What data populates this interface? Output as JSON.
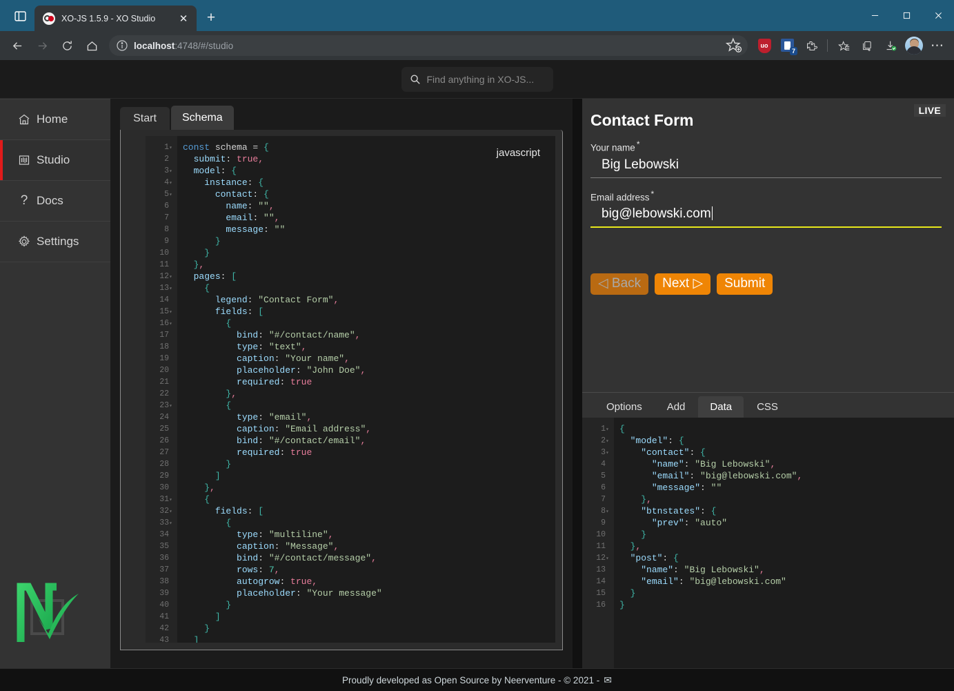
{
  "browser": {
    "tab_title": "XO-JS 1.5.9 - XO Studio",
    "tab_close_label": "✕",
    "new_tab_label": "+",
    "url_host": "localhost",
    "url_path": ":4748/#/studio",
    "extension_count": "7",
    "uo_label": "uo",
    "more_label": "⋯",
    "minimize_label": "─",
    "maximize_label": "□",
    "close_label": "✕"
  },
  "search": {
    "placeholder": "Find anything in XO-JS...",
    "icon": "search-icon"
  },
  "sidebar": {
    "items": [
      {
        "label": "Home",
        "icon": "home-icon",
        "active": false
      },
      {
        "label": "Studio",
        "icon": "studio-icon",
        "active": true
      },
      {
        "label": "Docs",
        "icon": "question-icon",
        "active": false
      },
      {
        "label": "Settings",
        "icon": "gear-icon",
        "active": false
      }
    ],
    "accent_color": "#e01b1b",
    "logo_name": "neerventure-logo"
  },
  "editor": {
    "tabs": [
      {
        "label": "Start",
        "active": false
      },
      {
        "label": "Schema",
        "active": true
      }
    ],
    "language_badge": "javascript",
    "line_count": 44,
    "fold_lines": [
      1,
      3,
      4,
      5,
      12,
      13,
      15,
      16,
      23,
      31,
      32,
      33
    ],
    "code": [
      [
        [
          "k",
          "const "
        ],
        [
          "op",
          "schema "
        ],
        [
          "op",
          "= "
        ],
        [
          "br",
          "{"
        ]
      ],
      [
        [
          "op",
          "  "
        ],
        [
          "p",
          "submit"
        ],
        [
          "op",
          ": "
        ],
        [
          "b",
          "true"
        ],
        [
          "b",
          ","
        ]
      ],
      [
        [
          "op",
          "  "
        ],
        [
          "p",
          "model"
        ],
        [
          "op",
          ": "
        ],
        [
          "br",
          "{"
        ]
      ],
      [
        [
          "op",
          "    "
        ],
        [
          "p",
          "instance"
        ],
        [
          "op",
          ": "
        ],
        [
          "br",
          "{"
        ]
      ],
      [
        [
          "op",
          "      "
        ],
        [
          "p",
          "contact"
        ],
        [
          "op",
          ": "
        ],
        [
          "br",
          "{"
        ]
      ],
      [
        [
          "op",
          "        "
        ],
        [
          "p",
          "name"
        ],
        [
          "op",
          ": "
        ],
        [
          "s",
          "\"\""
        ],
        [
          "b",
          ","
        ]
      ],
      [
        [
          "op",
          "        "
        ],
        [
          "p",
          "email"
        ],
        [
          "op",
          ": "
        ],
        [
          "s",
          "\"\""
        ],
        [
          "b",
          ","
        ]
      ],
      [
        [
          "op",
          "        "
        ],
        [
          "p",
          "message"
        ],
        [
          "op",
          ": "
        ],
        [
          "s",
          "\"\""
        ]
      ],
      [
        [
          "op",
          "      "
        ],
        [
          "br",
          "}"
        ]
      ],
      [
        [
          "op",
          "    "
        ],
        [
          "br",
          "}"
        ]
      ],
      [
        [
          "op",
          "  "
        ],
        [
          "br",
          "}"
        ],
        [
          "b",
          ","
        ]
      ],
      [
        [
          "op",
          "  "
        ],
        [
          "p",
          "pages"
        ],
        [
          "op",
          ": "
        ],
        [
          "br",
          "["
        ]
      ],
      [
        [
          "op",
          "    "
        ],
        [
          "br",
          "{"
        ]
      ],
      [
        [
          "op",
          "      "
        ],
        [
          "p",
          "legend"
        ],
        [
          "op",
          ": "
        ],
        [
          "s",
          "\"Contact Form\""
        ],
        [
          "b",
          ","
        ]
      ],
      [
        [
          "op",
          "      "
        ],
        [
          "p",
          "fields"
        ],
        [
          "op",
          ": "
        ],
        [
          "br",
          "["
        ]
      ],
      [
        [
          "op",
          "        "
        ],
        [
          "br",
          "{"
        ]
      ],
      [
        [
          "op",
          "          "
        ],
        [
          "p",
          "bind"
        ],
        [
          "op",
          ": "
        ],
        [
          "s",
          "\"#/contact/name\""
        ],
        [
          "b",
          ","
        ]
      ],
      [
        [
          "op",
          "          "
        ],
        [
          "p",
          "type"
        ],
        [
          "op",
          ": "
        ],
        [
          "s",
          "\"text\""
        ],
        [
          "b",
          ","
        ]
      ],
      [
        [
          "op",
          "          "
        ],
        [
          "p",
          "caption"
        ],
        [
          "op",
          ": "
        ],
        [
          "s",
          "\"Your name\""
        ],
        [
          "b",
          ","
        ]
      ],
      [
        [
          "op",
          "          "
        ],
        [
          "p",
          "placeholder"
        ],
        [
          "op",
          ": "
        ],
        [
          "s",
          "\"John Doe\""
        ],
        [
          "b",
          ","
        ]
      ],
      [
        [
          "op",
          "          "
        ],
        [
          "p",
          "required"
        ],
        [
          "op",
          ": "
        ],
        [
          "b",
          "true"
        ]
      ],
      [
        [
          "op",
          "        "
        ],
        [
          "br",
          "}"
        ],
        [
          "b",
          ","
        ]
      ],
      [
        [
          "op",
          "        "
        ],
        [
          "br",
          "{"
        ]
      ],
      [
        [
          "op",
          "          "
        ],
        [
          "p",
          "type"
        ],
        [
          "op",
          ": "
        ],
        [
          "s",
          "\"email\""
        ],
        [
          "b",
          ","
        ]
      ],
      [
        [
          "op",
          "          "
        ],
        [
          "p",
          "caption"
        ],
        [
          "op",
          ": "
        ],
        [
          "s",
          "\"Email address\""
        ],
        [
          "b",
          ","
        ]
      ],
      [
        [
          "op",
          "          "
        ],
        [
          "p",
          "bind"
        ],
        [
          "op",
          ": "
        ],
        [
          "s",
          "\"#/contact/email\""
        ],
        [
          "b",
          ","
        ]
      ],
      [
        [
          "op",
          "          "
        ],
        [
          "p",
          "required"
        ],
        [
          "op",
          ": "
        ],
        [
          "b",
          "true"
        ]
      ],
      [
        [
          "op",
          "        "
        ],
        [
          "br",
          "}"
        ]
      ],
      [
        [
          "op",
          "      "
        ],
        [
          "br",
          "]"
        ]
      ],
      [
        [
          "op",
          "    "
        ],
        [
          "br",
          "}"
        ],
        [
          "b",
          ","
        ]
      ],
      [
        [
          "op",
          "    "
        ],
        [
          "br",
          "{"
        ]
      ],
      [
        [
          "op",
          "      "
        ],
        [
          "p",
          "fields"
        ],
        [
          "op",
          ": "
        ],
        [
          "br",
          "["
        ]
      ],
      [
        [
          "op",
          "        "
        ],
        [
          "br",
          "{"
        ]
      ],
      [
        [
          "op",
          "          "
        ],
        [
          "p",
          "type"
        ],
        [
          "op",
          ": "
        ],
        [
          "s",
          "\"multiline\""
        ],
        [
          "b",
          ","
        ]
      ],
      [
        [
          "op",
          "          "
        ],
        [
          "p",
          "caption"
        ],
        [
          "op",
          ": "
        ],
        [
          "s",
          "\"Message\""
        ],
        [
          "b",
          ","
        ]
      ],
      [
        [
          "op",
          "          "
        ],
        [
          "p",
          "bind"
        ],
        [
          "op",
          ": "
        ],
        [
          "s",
          "\"#/contact/message\""
        ],
        [
          "b",
          ","
        ]
      ],
      [
        [
          "op",
          "          "
        ],
        [
          "p",
          "rows"
        ],
        [
          "op",
          ": "
        ],
        [
          "n",
          "7"
        ],
        [
          "b",
          ","
        ]
      ],
      [
        [
          "op",
          "          "
        ],
        [
          "p",
          "autogrow"
        ],
        [
          "op",
          ": "
        ],
        [
          "b",
          "true"
        ],
        [
          "b",
          ","
        ]
      ],
      [
        [
          "op",
          "          "
        ],
        [
          "p",
          "placeholder"
        ],
        [
          "op",
          ": "
        ],
        [
          "s",
          "\"Your message\""
        ]
      ],
      [
        [
          "op",
          "        "
        ],
        [
          "br",
          "}"
        ]
      ],
      [
        [
          "op",
          "      "
        ],
        [
          "br",
          "]"
        ]
      ],
      [
        [
          "op",
          "    "
        ],
        [
          "br",
          "}"
        ]
      ],
      [
        [
          "op",
          "  "
        ],
        [
          "br",
          "]"
        ]
      ],
      [
        [
          "op",
          ""
        ],
        [
          "br",
          "}"
        ],
        [
          "b",
          ";"
        ]
      ]
    ]
  },
  "preview": {
    "live_label": "LIVE",
    "title": "Contact Form",
    "fields": [
      {
        "caption": "Your name",
        "required_mark": "*",
        "value": "Big Lebowski",
        "focused": false
      },
      {
        "caption": "Email address",
        "required_mark": "*",
        "value": "big@lebowski.com",
        "focused": true
      }
    ],
    "buttons": [
      {
        "label": "◁ Back",
        "name": "back-button",
        "disabled": true
      },
      {
        "label": "Next ▷",
        "name": "next-button",
        "disabled": false
      },
      {
        "label": "Submit",
        "name": "submit-button",
        "disabled": false
      }
    ],
    "accent_color": "#ef8505",
    "focus_color": "#e8e81b"
  },
  "bottom_panel": {
    "tabs": [
      {
        "label": "Options",
        "active": false
      },
      {
        "label": "Add",
        "active": false
      },
      {
        "label": "Data",
        "active": true
      },
      {
        "label": "CSS",
        "active": false
      }
    ],
    "line_count": 16,
    "fold_lines": [
      1,
      2,
      3,
      8,
      12
    ],
    "code": [
      [
        [
          "br",
          "{"
        ]
      ],
      [
        [
          "op",
          "  "
        ],
        [
          "p",
          "\"model\""
        ],
        [
          "op",
          ": "
        ],
        [
          "br",
          "{"
        ]
      ],
      [
        [
          "op",
          "    "
        ],
        [
          "p",
          "\"contact\""
        ],
        [
          "op",
          ": "
        ],
        [
          "br",
          "{"
        ]
      ],
      [
        [
          "op",
          "      "
        ],
        [
          "p",
          "\"name\""
        ],
        [
          "op",
          ": "
        ],
        [
          "s",
          "\"Big Lebowski\""
        ],
        [
          "b",
          ","
        ]
      ],
      [
        [
          "op",
          "      "
        ],
        [
          "p",
          "\"email\""
        ],
        [
          "op",
          ": "
        ],
        [
          "s",
          "\"big@lebowski.com\""
        ],
        [
          "b",
          ","
        ]
      ],
      [
        [
          "op",
          "      "
        ],
        [
          "p",
          "\"message\""
        ],
        [
          "op",
          ": "
        ],
        [
          "s",
          "\"\""
        ]
      ],
      [
        [
          "op",
          "    "
        ],
        [
          "br",
          "}"
        ],
        [
          "b",
          ","
        ]
      ],
      [
        [
          "op",
          "    "
        ],
        [
          "p",
          "\"btnstates\""
        ],
        [
          "op",
          ": "
        ],
        [
          "br",
          "{"
        ]
      ],
      [
        [
          "op",
          "      "
        ],
        [
          "p",
          "\"prev\""
        ],
        [
          "op",
          ": "
        ],
        [
          "s",
          "\"auto\""
        ]
      ],
      [
        [
          "op",
          "    "
        ],
        [
          "br",
          "}"
        ]
      ],
      [
        [
          "op",
          "  "
        ],
        [
          "br",
          "}"
        ],
        [
          "b",
          ","
        ]
      ],
      [
        [
          "op",
          "  "
        ],
        [
          "p",
          "\"post\""
        ],
        [
          "op",
          ": "
        ],
        [
          "br",
          "{"
        ]
      ],
      [
        [
          "op",
          "    "
        ],
        [
          "p",
          "\"name\""
        ],
        [
          "op",
          ": "
        ],
        [
          "s",
          "\"Big Lebowski\""
        ],
        [
          "b",
          ","
        ]
      ],
      [
        [
          "op",
          "    "
        ],
        [
          "p",
          "\"email\""
        ],
        [
          "op",
          ": "
        ],
        [
          "s",
          "\"big@lebowski.com\""
        ]
      ],
      [
        [
          "op",
          "  "
        ],
        [
          "br",
          "}"
        ]
      ],
      [
        [
          "br",
          "}"
        ]
      ]
    ]
  },
  "footer": {
    "text": "Proudly developed as Open Source by Neerventure - © 2021 -",
    "mail_icon": "✉"
  }
}
